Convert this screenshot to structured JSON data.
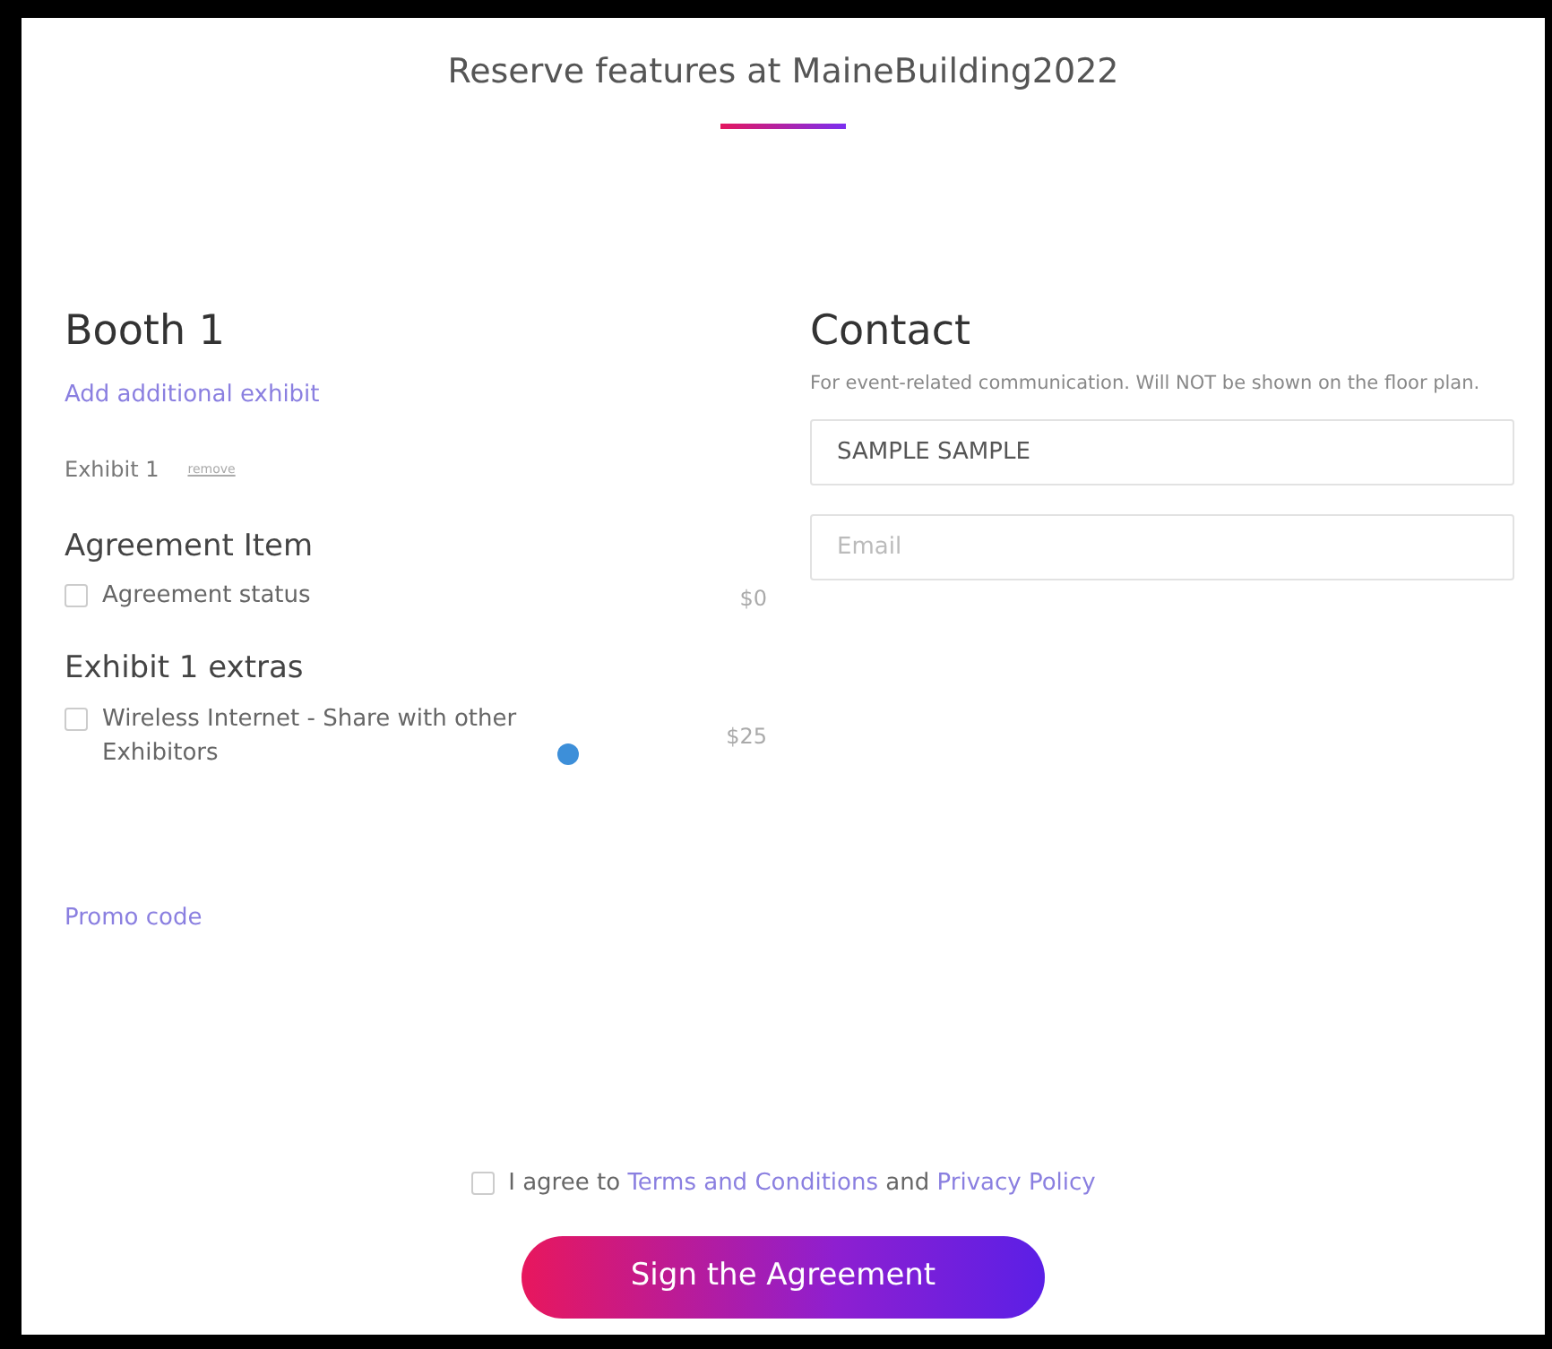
{
  "title": "Reserve features at MaineBuilding2022",
  "booth": {
    "heading": "Booth 1",
    "add_link": "Add additional exhibit",
    "exhibit_label": "Exhibit 1",
    "remove_link": "remove",
    "sections": [
      {
        "heading": "Agreement Item",
        "items": [
          {
            "label": "Agreement status",
            "price": "$0",
            "checked": false,
            "info": false
          }
        ]
      },
      {
        "heading": "Exhibit 1 extras",
        "items": [
          {
            "label": "Wireless Internet - Share with other Exhibitors",
            "price": "$25",
            "checked": false,
            "info": true
          }
        ]
      }
    ],
    "promo_link": "Promo code"
  },
  "contact": {
    "heading": "Contact",
    "note": "For event-related communication. Will NOT be shown on the floor plan.",
    "fields": [
      {
        "value": "SAMPLE SAMPLE"
      },
      {
        "placeholder": "Email"
      }
    ]
  },
  "agreement": {
    "checked": false,
    "parts": [
      {
        "kind": "text",
        "text": "I agree to"
      },
      {
        "kind": "link",
        "text": "Terms and Conditions"
      },
      {
        "kind": "text",
        "text": "and"
      },
      {
        "kind": "link",
        "text": "Privacy Policy"
      }
    ]
  },
  "submit": "Sign the Agreement"
}
